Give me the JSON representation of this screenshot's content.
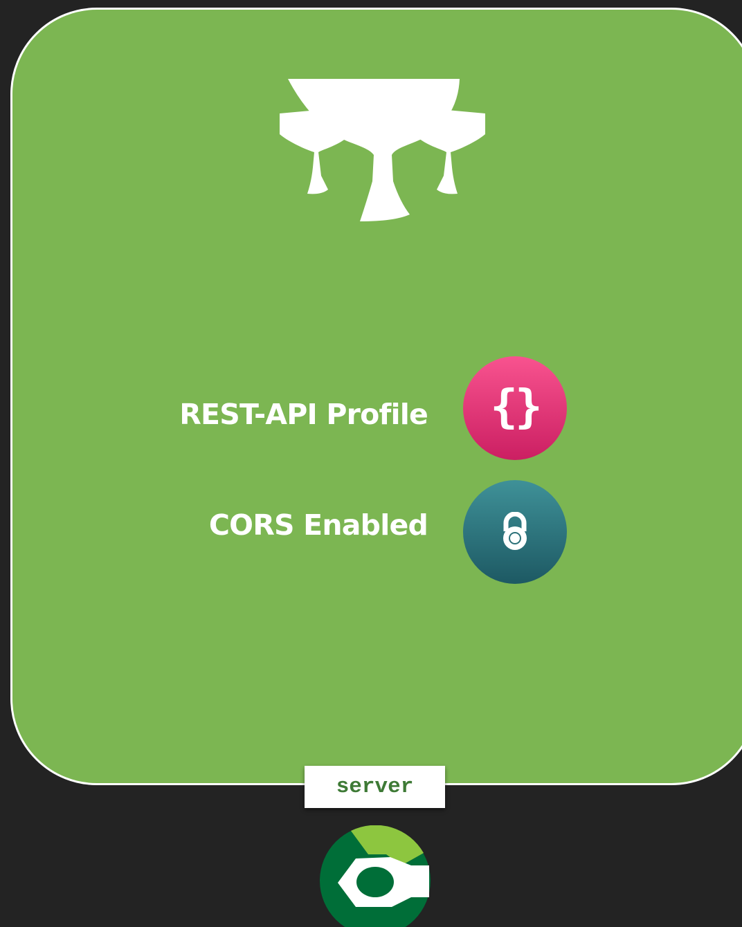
{
  "features": [
    {
      "label": "REST-API Profile",
      "icon": "curly-braces-icon",
      "icon_text": "{}",
      "color": "#e63275"
    },
    {
      "label": "CORS Enabled",
      "icon": "padlock-icon",
      "color": "#2b7078"
    }
  ],
  "server_tag": {
    "label": "server"
  },
  "colors": {
    "background": "#232323",
    "card": "#7cb652",
    "card_border": "#ffffff",
    "server_text": "#3e7a36",
    "server_logo_dark": "#006e38",
    "server_logo_light": "#8dc63f"
  },
  "icons": {
    "top_logo": "chalices-icon",
    "bottom_logo": "hexagon-ring-logo-icon"
  }
}
